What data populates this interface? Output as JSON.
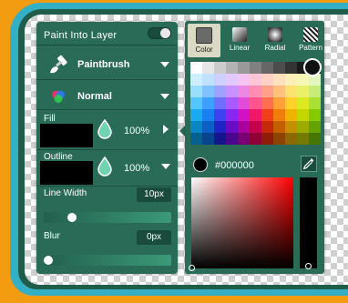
{
  "layer": {
    "label": "Paint Into Layer",
    "toggle_on": false
  },
  "tool": {
    "label": "Paintbrush",
    "icon": "paintbrush-icon"
  },
  "blend": {
    "label": "Normal",
    "icon": "blend-mode-icon"
  },
  "fill": {
    "label": "Fill",
    "color": "#000000",
    "opacity": "100%"
  },
  "outline": {
    "label": "Outline",
    "color": "#000000",
    "opacity": "100%"
  },
  "line_width": {
    "label": "Line Width",
    "value": "10px",
    "slider_fraction": 0.2
  },
  "blur": {
    "label": "Blur",
    "value": "0px",
    "slider_fraction": 0.0
  },
  "tabs": [
    {
      "label": "Color",
      "active": true,
      "icon": "color-swatch-icon"
    },
    {
      "label": "Linear",
      "active": false,
      "icon": "linear-gradient-icon"
    },
    {
      "label": "Radial",
      "active": false,
      "icon": "radial-gradient-icon"
    },
    {
      "label": "Pattern",
      "active": false,
      "icon": "pattern-icon"
    }
  ],
  "palette": {
    "rows": [
      [
        "#ffffff",
        "#e6e6e6",
        "#cccccc",
        "#b3b3b3",
        "#999999",
        "#808080",
        "#666666",
        "#4d4d4d",
        "#333333",
        "#1a1a1a",
        "#000000"
      ],
      [
        "#cceeff",
        "#bfe0ff",
        "#cfd0ff",
        "#e3c8ff",
        "#f6c4f2",
        "#ffc6d8",
        "#ffd0c4",
        "#ffe0bd",
        "#fff0b8",
        "#f4f8b4",
        "#e4f6bd"
      ],
      [
        "#99ddff",
        "#80c1ff",
        "#9fa1ff",
        "#c791ff",
        "#ec88e4",
        "#ff8db1",
        "#ffa089",
        "#ffc17b",
        "#ffe170",
        "#e9f16a",
        "#c8ec7a"
      ],
      [
        "#55c6ff",
        "#3f9fff",
        "#6d70ff",
        "#a95aff",
        "#e04cd7",
        "#ff548c",
        "#ff6e4f",
        "#ff9f38",
        "#ffd12a",
        "#dbe923",
        "#a8e033"
      ],
      [
        "#1aaaf0",
        "#1a7ff0",
        "#3f42ef",
        "#8a26f0",
        "#d011c4",
        "#f01766",
        "#f0401a",
        "#f07d0a",
        "#f0b400",
        "#c4d600",
        "#84cc00"
      ],
      [
        "#0a86c4",
        "#0a60c4",
        "#2023c4",
        "#6a0cc4",
        "#a8009e",
        "#c4004c",
        "#c4290a",
        "#c45f00",
        "#c49000",
        "#9cab00",
        "#64a300"
      ],
      [
        "#06608e",
        "#06448e",
        "#14168e",
        "#4c068e",
        "#790072",
        "#8e0036",
        "#8e1c06",
        "#8e4400",
        "#8e6800",
        "#717c00",
        "#477600"
      ]
    ]
  },
  "color": {
    "hex": "#000000",
    "selected": "#000000",
    "hue": "#ff0000"
  },
  "eyedropper": {
    "icon": "eyedropper-icon"
  }
}
